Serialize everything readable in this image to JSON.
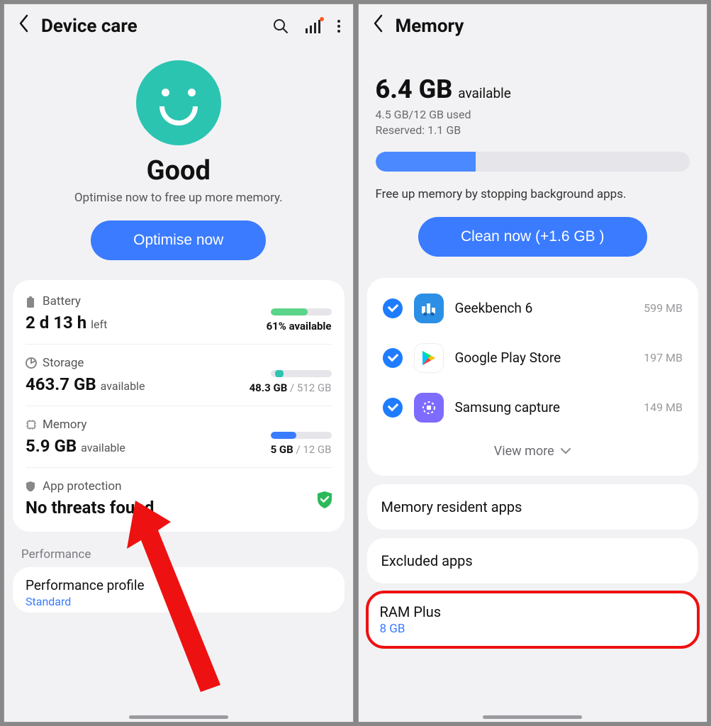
{
  "left": {
    "title": "Device care",
    "hero_status": "Good",
    "hero_sub": "Optimise now to free up more memory.",
    "optimise_btn": "Optimise now",
    "battery": {
      "label": "Battery",
      "value": "2 d 13 h",
      "value_suffix": "left",
      "pct_label": "61% available"
    },
    "storage": {
      "label": "Storage",
      "value": "463.7 GB",
      "value_suffix": "available",
      "used": "48.3 GB",
      "total": "/ 512 GB"
    },
    "memory": {
      "label": "Memory",
      "value": "5.9 GB",
      "value_suffix": "available",
      "used": "5 GB",
      "total": "/ 12 GB"
    },
    "protection": {
      "label": "App protection",
      "value": "No threats found"
    },
    "perf_section": "Performance",
    "perf_profile_title": "Performance profile",
    "perf_profile_value": "Standard"
  },
  "right": {
    "title": "Memory",
    "big_value": "6.4 GB",
    "big_suffix": "available",
    "line1": "4.5 GB/12 GB used",
    "line2": "Reserved: 1.1 GB",
    "freeup": "Free up memory by stopping background apps.",
    "clean_btn": "Clean now (+1.6 GB )",
    "apps": [
      {
        "name": "Geekbench 6",
        "size": "599 MB",
        "icon_bg": "#1e88e5"
      },
      {
        "name": "Google Play Store",
        "size": "197 MB",
        "icon_bg": "#ffffff"
      },
      {
        "name": "Samsung capture",
        "size": "149 MB",
        "icon_bg": "#7e6bff"
      }
    ],
    "view_more": "View more",
    "resident": "Memory resident apps",
    "excluded": "Excluded apps",
    "ramplus_title": "RAM Plus",
    "ramplus_value": "8 GB"
  }
}
